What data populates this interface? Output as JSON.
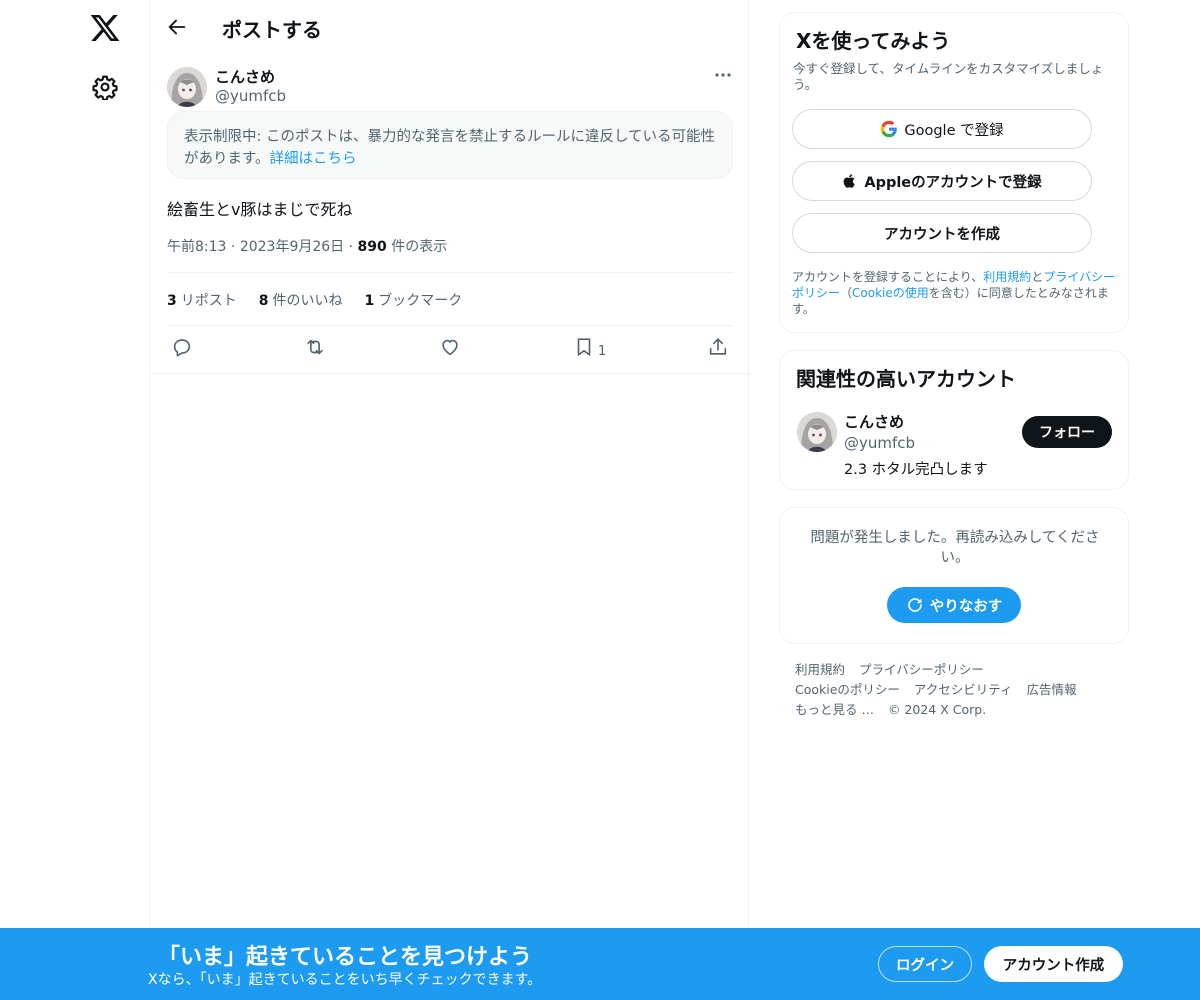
{
  "header": {
    "title": "ポストする"
  },
  "post": {
    "author_name": "こんさめ",
    "author_handle": "@yumfcb",
    "notice_text": "表示制限中: このポストは、暴力的な発言を禁止するルールに違反している可能性があります。",
    "notice_link": "詳細はこちら",
    "text": "絵畜生とv豚はまじで死ね",
    "time": "午前8:13",
    "date": "2023年9月26日",
    "views_count": "890",
    "views_label": "件の表示",
    "reposts_count": "3",
    "reposts_label": "リポスト",
    "likes_count": "8",
    "likes_label": "件のいいね",
    "bookmarks_count": "1",
    "bookmarks_label": "ブックマーク",
    "bookmark_action_count": "1"
  },
  "signup": {
    "title": "Xを使ってみよう",
    "subtitle": "今すぐ登録して、タイムラインをカスタマイズしましょう。",
    "google_label": "Google で登録",
    "apple_label": "Appleのアカウントで登録",
    "create_label": "アカウントを作成",
    "legal_prefix": "アカウントを登録することにより、",
    "legal_terms": "利用規約",
    "legal_and": "と",
    "legal_privacy": "プライバシーポリシー",
    "legal_paren_open": "（",
    "legal_cookie": "Cookieの使用",
    "legal_suffix": "を含む）に同意したとみなされます。"
  },
  "related": {
    "title": "関連性の高いアカウント",
    "name": "こんさめ",
    "handle": "@yumfcb",
    "bio": "2.3 ホタル完凸します",
    "follow_label": "フォロー"
  },
  "error_card": {
    "message": "問題が発生しました。再読み込みしてください。",
    "retry_label": "やりなおす"
  },
  "footer": {
    "links": [
      "利用規約",
      "プライバシーポリシー",
      "Cookieのポリシー",
      "アクセシビリティ",
      "広告情報",
      "もっと見る …",
      "© 2024 X Corp."
    ]
  },
  "bottom_bar": {
    "title": "「いま」起きていることを見つけよう",
    "subtitle": "Xなら、「いま」起きていることをいち早くチェックできます。",
    "login_label": "ログイン",
    "signup_label": "アカウント作成"
  },
  "colors": {
    "accent": "#1d9bf0",
    "text": "#0f1419",
    "muted": "#536471",
    "border": "#eff3f4"
  }
}
